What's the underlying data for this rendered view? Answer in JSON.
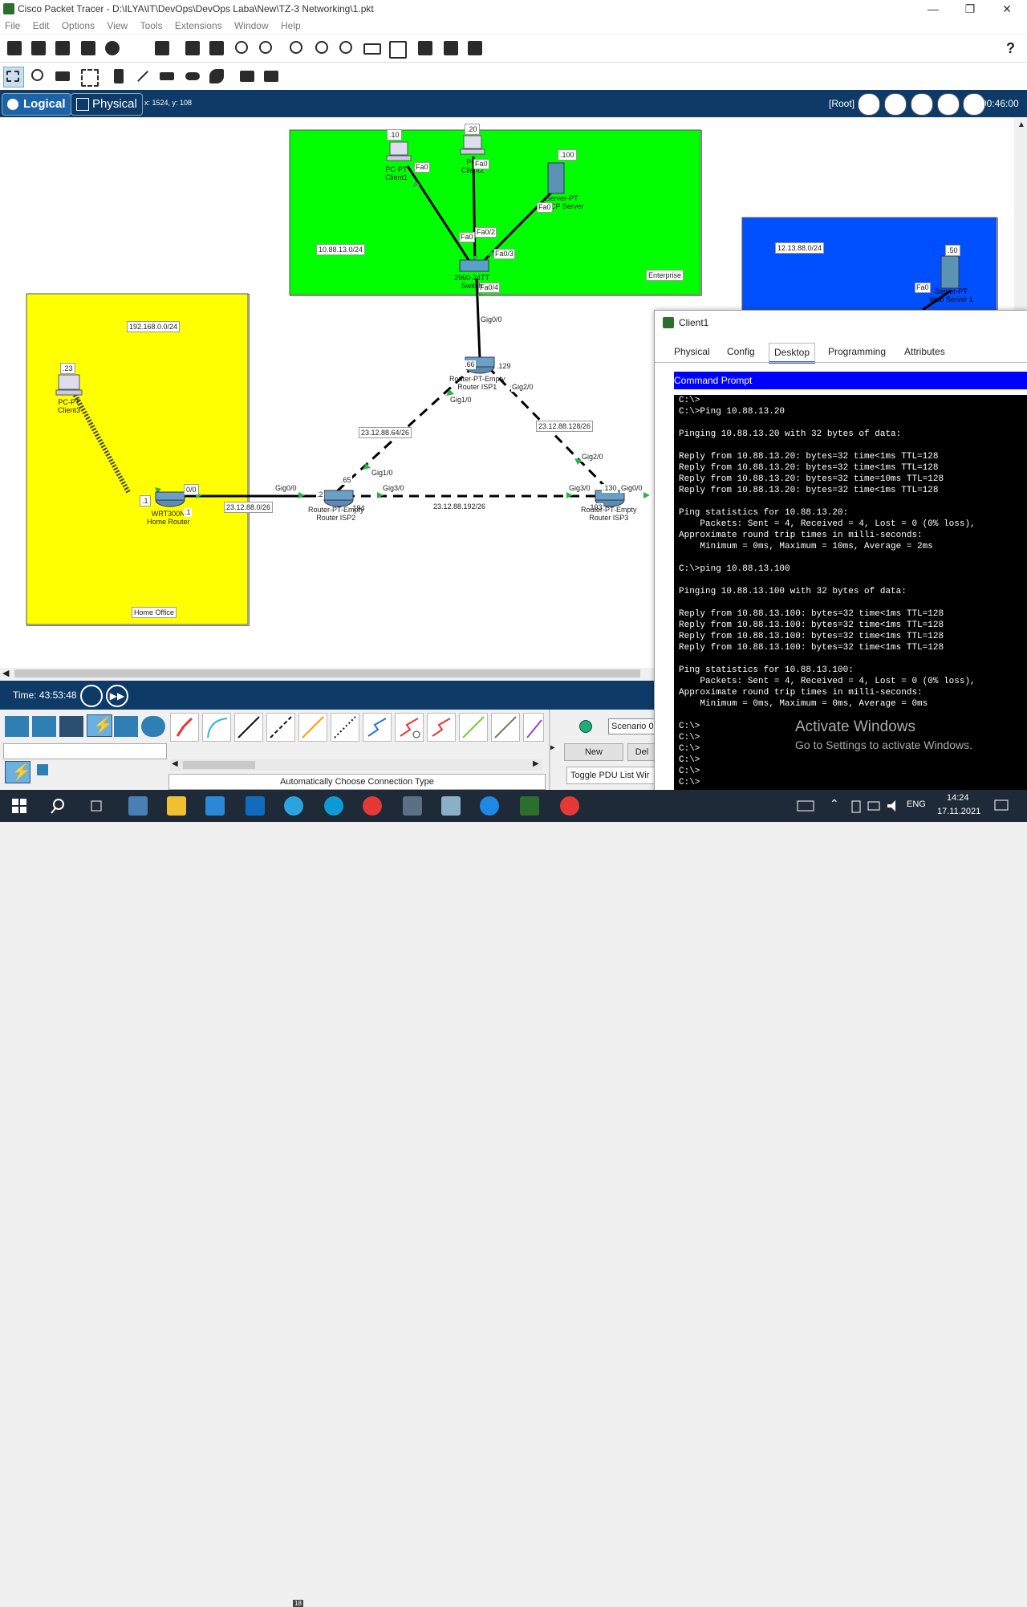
{
  "window": {
    "title": "Cisco Packet Tracer - D:\\ILYA\\IT\\DevOps\\DevOps Laba\\New\\TZ-3 Networking\\1.pkt"
  },
  "menu": [
    "File",
    "Edit",
    "Options",
    "View",
    "Tools",
    "Extensions",
    "Window",
    "Help"
  ],
  "help_label": "?",
  "nav": {
    "logical": "Logical",
    "physical": "Physical",
    "coords": "x: 1524, y: 108",
    "root": "[Root]",
    "clock": "00:46:00"
  },
  "areas": {
    "enterprise": {
      "label": "Enterprise",
      "subnet": "10.88.13.0/24",
      "color": "#00ff00"
    },
    "home": {
      "label": "Home Office",
      "subnet": "192.168.0.0/24",
      "color": "#ffff00"
    },
    "web": {
      "subnet": "12.13.88.0/24",
      "color": "#0050ff"
    }
  },
  "devices": {
    "client1": {
      "ip": ".10",
      "name1": "PC-PT",
      "name2": "Client1",
      "port": "Fa0"
    },
    "client2": {
      "ip": ".20",
      "name1": "PC-",
      "name2": "Client2",
      "port": "Fa0"
    },
    "dhcp": {
      "ip": ".100",
      "name1": "Server-PT",
      "name2": "DHCP Server",
      "port": "Fa0"
    },
    "switch": {
      "name1": "2960-24TT",
      "name2": "Switch",
      "ports": [
        "Fa0",
        "Fa0/2",
        "Fa0/3",
        "Fa0/4"
      ]
    },
    "webserver": {
      "ip": ".50",
      "name1": "Server-PT",
      "name2": "Web Server 1",
      "port": "Fa0"
    },
    "client3": {
      "ip": ".23",
      "name1": "PC-PT",
      "name2": "Client3"
    },
    "home_router": {
      "name1": "WRT300N",
      "name2": "Home Router",
      "ip_in": ".1",
      "ip_out": ".1",
      "port": "0/0"
    },
    "isp1": {
      "name1": "Router-PT-Empty",
      "name2": "Router ISP1",
      "ip_a": ".66",
      "ip_b": ".129",
      "ports": [
        "Gig0/0",
        "Gig1/0",
        "Gig2/0"
      ]
    },
    "isp2": {
      "name1": "Router-PT-Empty",
      "name2": "Router ISP2",
      "ip_a": ".2",
      "ip_b": ".65",
      "ip_c": ".194",
      "ports": [
        "Gig0/0",
        "Gig1/0",
        "Gig3/0"
      ]
    },
    "isp3": {
      "name1": "Router-PT-Empty",
      "name2": "Router ISP3",
      "ip_a": ".193",
      "ip_b": ".130",
      "ports": [
        "Gig3/0",
        "Gig0/0",
        "Gig2/0"
      ]
    }
  },
  "links": {
    "home_isp2": "23.12.88.0/26",
    "isp2_isp1": "23.12.88.64/26",
    "isp1_isp3": "23.12.88.128/26",
    "isp2_isp3": "23.12.88.192/26"
  },
  "sim": {
    "time": "Time: 43:53:48"
  },
  "connections_label": "Automatically Choose Connection Type",
  "pdu": {
    "scenario": "Scenario 0",
    "new": "New",
    "delete": "Del",
    "toggle": "Toggle PDU List Wir"
  },
  "client_window": {
    "title": "Client1",
    "tabs": [
      "Physical",
      "Config",
      "Desktop",
      "Programming",
      "Attributes"
    ],
    "active_tab": "Desktop",
    "app_title": "Command Prompt",
    "lines": [
      "C:\\>",
      "C:\\>Ping 10.88.13.20",
      "",
      "Pinging 10.88.13.20 with 32 bytes of data:",
      "",
      "Reply from 10.88.13.20: bytes=32 time<1ms TTL=128",
      "Reply from 10.88.13.20: bytes=32 time<1ms TTL=128",
      "Reply from 10.88.13.20: bytes=32 time=10ms TTL=128",
      "Reply from 10.88.13.20: bytes=32 time<1ms TTL=128",
      "",
      "Ping statistics for 10.88.13.20:",
      "    Packets: Sent = 4, Received = 4, Lost = 0 (0% loss),",
      "Approximate round trip times in milli-seconds:",
      "    Minimum = 0ms, Maximum = 10ms, Average = 2ms",
      "",
      "C:\\>ping 10.88.13.100",
      "",
      "Pinging 10.88.13.100 with 32 bytes of data:",
      "",
      "Reply from 10.88.13.100: bytes=32 time<1ms TTL=128",
      "Reply from 10.88.13.100: bytes=32 time<1ms TTL=128",
      "Reply from 10.88.13.100: bytes=32 time<1ms TTL=128",
      "Reply from 10.88.13.100: bytes=32 time<1ms TTL=128",
      "",
      "Ping statistics for 10.88.13.100:",
      "    Packets: Sent = 4, Received = 4, Lost = 0 (0% loss),",
      "Approximate round trip times in milli-seconds:",
      "    Minimum = 0ms, Maximum = 0ms, Average = 0ms",
      "",
      "C:\\>",
      "C:\\>",
      "C:\\>",
      "C:\\>",
      "C:\\>",
      "C:\\>"
    ]
  },
  "watermark": {
    "line1": "Activate Windows",
    "line2": "Go to Settings to activate Windows."
  },
  "taskbar": {
    "lang": "ENG",
    "time": "14:24",
    "date": "17.11.2021",
    "badge": "18"
  }
}
